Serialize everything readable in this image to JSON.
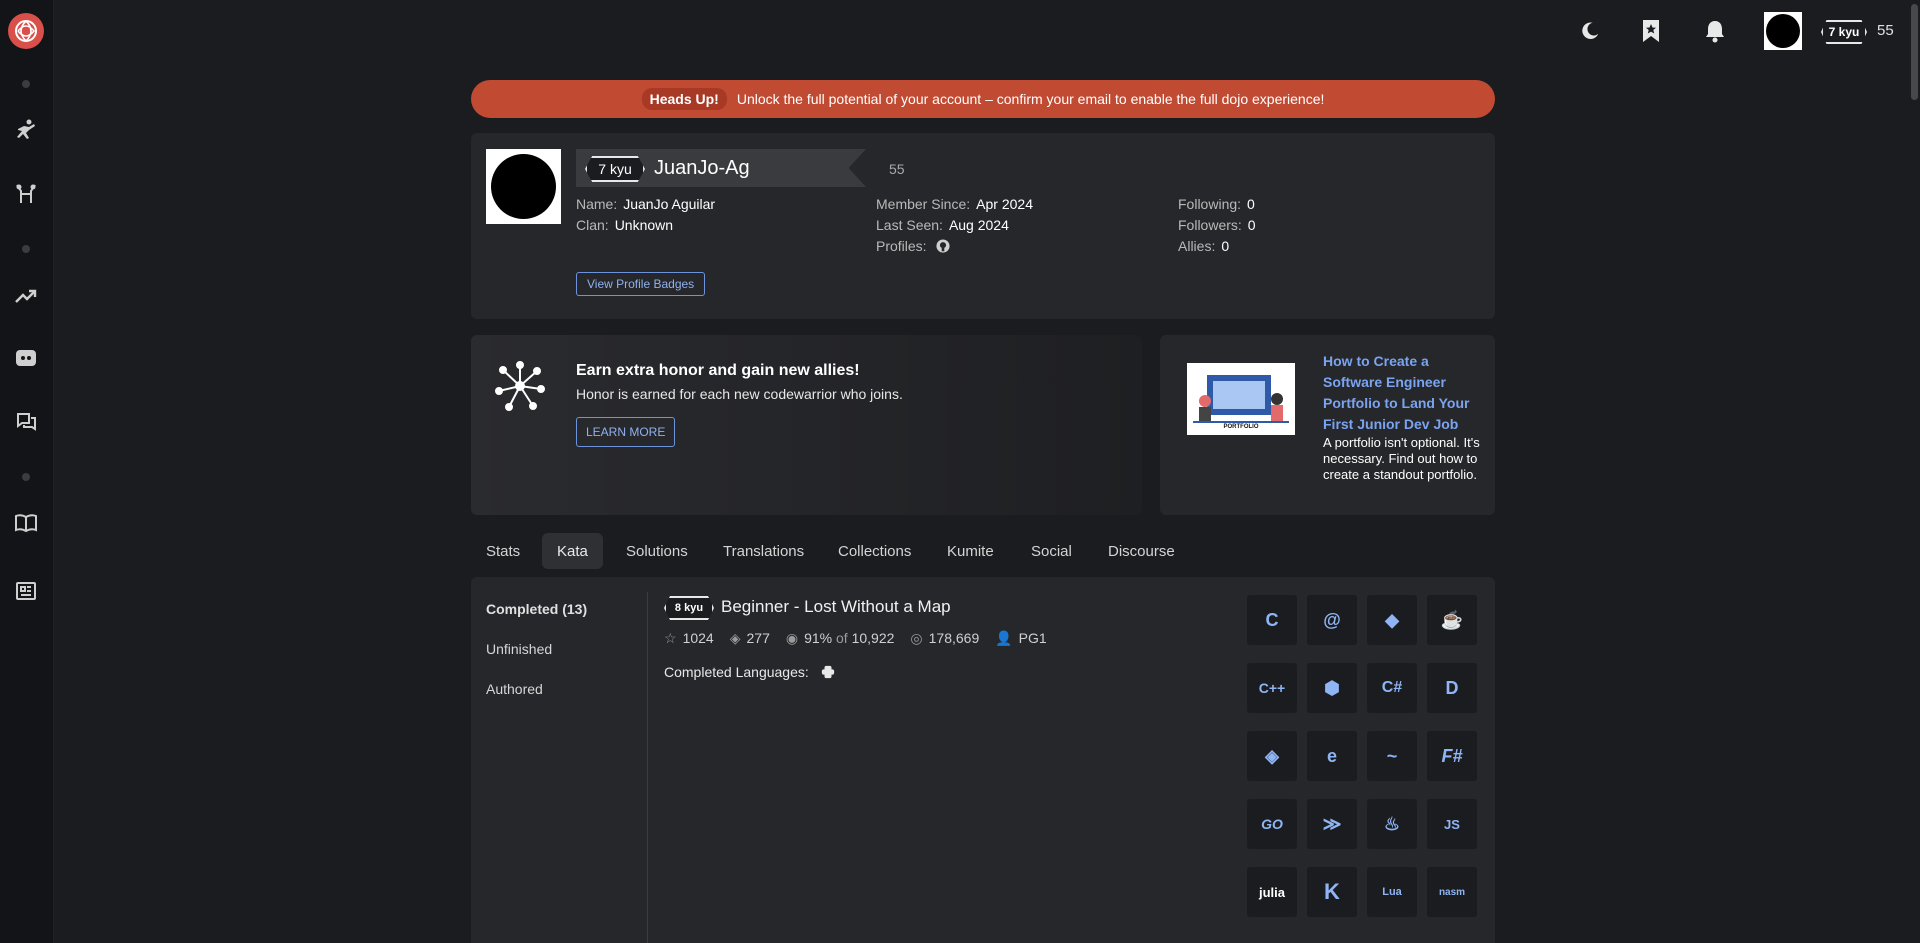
{
  "topbar": {
    "rank": "7 kyu",
    "honor": "55"
  },
  "banner": {
    "label": "Heads Up!",
    "message": "Unlock the full potential of your account – confirm your email to enable the full dojo experience!"
  },
  "profile": {
    "rank": "7 kyu",
    "username": "JuanJo-Ag",
    "honor": "55",
    "name_label": "Name:",
    "name": "JuanJo Aguilar",
    "clan_label": "Clan:",
    "clan": "Unknown",
    "member_since_label": "Member Since:",
    "member_since": "Apr 2024",
    "last_seen_label": "Last Seen:",
    "last_seen": "Aug 2024",
    "profiles_label": "Profiles:",
    "following_label": "Following:",
    "following": "0",
    "followers_label": "Followers:",
    "followers": "0",
    "allies_label": "Allies:",
    "allies": "0",
    "badges_button": "View Profile Badges"
  },
  "promo": {
    "title": "Earn extra honor and gain new allies!",
    "subtitle": "Honor is earned for each new codewarrior who joins.",
    "button": "LEARN MORE"
  },
  "article": {
    "image_caption": "PORTFOLIO",
    "title": "How to Create a Software Engineer Portfolio to Land Your First Junior Dev Job",
    "description": "A portfolio isn't optional. It's necessary. Find out how to create a standout portfolio."
  },
  "tabs": [
    "Stats",
    "Kata",
    "Solutions",
    "Translations",
    "Collections",
    "Kumite",
    "Social",
    "Discourse"
  ],
  "kata_sidebar": [
    "Completed (13)",
    "Unfinished",
    "Authored"
  ],
  "kata": {
    "rank": "8 kyu",
    "title": "Beginner - Lost Without a Map",
    "stars": "1024",
    "collections": "277",
    "satisfaction_pct": "91%",
    "satisfaction_of": "of",
    "votes": "10,922",
    "completions": "178,669",
    "author": "PG1",
    "completed_languages_label": "Completed Languages:"
  },
  "languages": [
    "C",
    "CoffeeScript",
    "COBOL",
    "CFML",
    "C++",
    "Crystal",
    "C#",
    "D",
    "Dart",
    "Elixir",
    "Erlang",
    "F#",
    "Go",
    "Haskell",
    "Java",
    "JavaScript",
    "julia",
    "Kotlin",
    "Lua",
    "NASM"
  ],
  "language_labels": [
    "C",
    "@",
    "◆",
    "☕",
    "C++",
    "⬢",
    "C#",
    "D",
    "◈",
    "e",
    "~",
    "F#",
    "GO",
    "≫",
    "♨",
    "JS",
    "julia",
    "K",
    "Lua",
    "nasm"
  ],
  "colors": {
    "accent": "#d9504a",
    "banner": "#c04a32",
    "link": "#7aa4f0",
    "lang": "#8fb5f5"
  }
}
